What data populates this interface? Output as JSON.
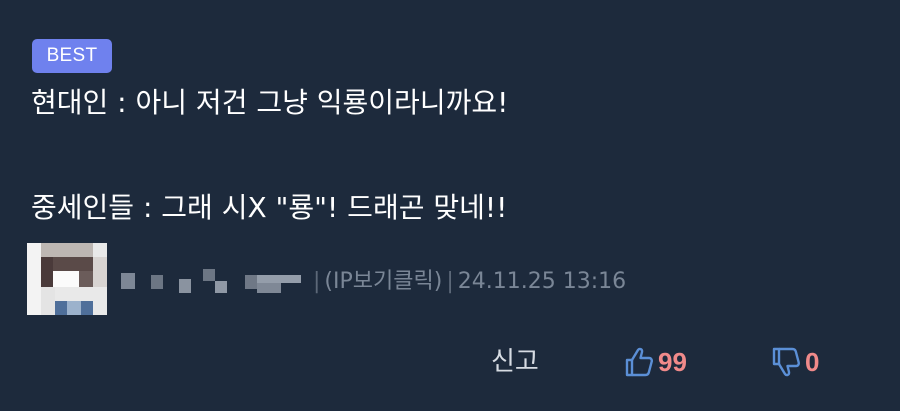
{
  "badge": {
    "label": "BEST"
  },
  "comment": {
    "lines": [
      "현대인 : 아니 저건 그냥 익룡이라니까요!",
      "중세인들 : 그래 시X \"룡\"! 드래곤 맞네!!"
    ]
  },
  "meta": {
    "ip_label": "(IP보기클릭)",
    "timestamp": "24.11.25 13:16",
    "separator": "|"
  },
  "actions": {
    "report_label": "신고",
    "upvote_count": "99",
    "downvote_count": "0"
  },
  "icons": {
    "upvote": "thumbs-up-icon",
    "downvote": "thumbs-down-icon"
  },
  "colors": {
    "background": "#1d2a3c",
    "badge": "#6f81ee",
    "text": "#ffffff",
    "meta_text": "#7a8696",
    "count": "#f08a8a",
    "icon": "#5b8fd6"
  }
}
